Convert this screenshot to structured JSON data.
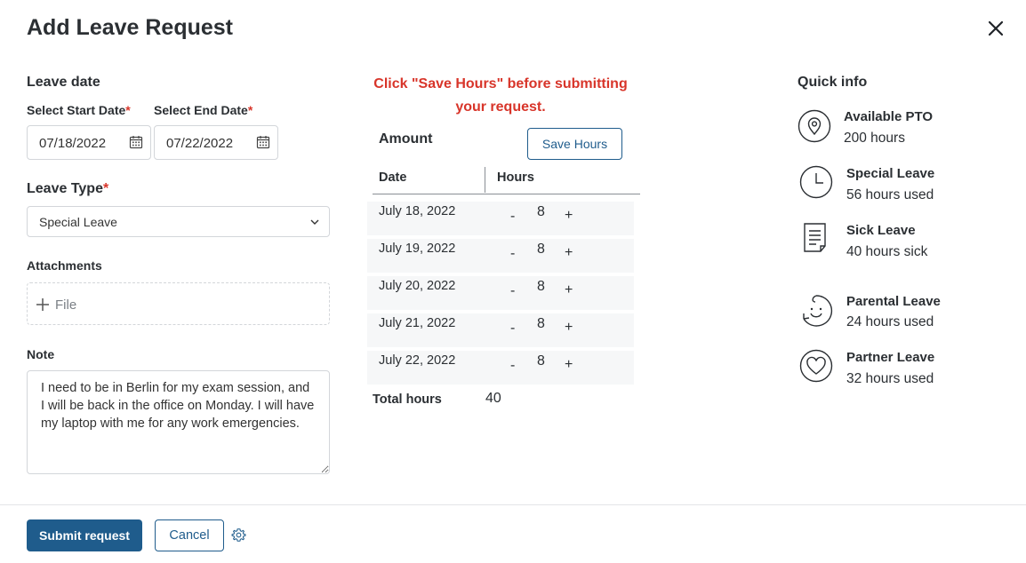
{
  "dialog": {
    "title": "Add Leave Request"
  },
  "leave_date": {
    "heading": "Leave date",
    "start_label": "Select Start Date",
    "end_label": "Select End Date",
    "required_mark": "*",
    "start_value": "07/18/2022",
    "end_value": "07/22/2022"
  },
  "leave_type": {
    "label": "Leave Type",
    "required_mark": "*",
    "value": "Special Leave"
  },
  "attachments": {
    "label": "Attachments",
    "file_label": "File"
  },
  "note": {
    "label": "Note",
    "value": "I need to be in Berlin for my exam session, and I will be back in the office on Monday. I will have my laptop with me for any work emergencies."
  },
  "amount": {
    "warning": "Click \"Save Hours\" before submitting your request.",
    "label": "Amount",
    "save_label": "Save Hours",
    "col_date": "Date",
    "col_hours": "Hours",
    "rows": [
      {
        "date": "July 18, 2022",
        "minus": "-",
        "hours": "8",
        "plus": "+"
      },
      {
        "date": "July 19, 2022",
        "minus": "-",
        "hours": "8",
        "plus": "+"
      },
      {
        "date": "July 20, 2022",
        "minus": "-",
        "hours": "8",
        "plus": "+"
      },
      {
        "date": "July 21, 2022",
        "minus": "-",
        "hours": "8",
        "plus": "+"
      },
      {
        "date": "July 22, 2022",
        "minus": "-",
        "hours": "8",
        "plus": "+"
      }
    ],
    "total_label": "Total hours",
    "total_value": "40"
  },
  "quick_info": {
    "heading": "Quick info",
    "items": [
      {
        "icon": "location-pin-icon",
        "title": "Available PTO",
        "sub": "200 hours"
      },
      {
        "icon": "clock-icon",
        "title": "Special Leave",
        "sub": "56 hours used"
      },
      {
        "icon": "document-icon",
        "title": "Sick Leave",
        "sub": "40 hours sick"
      },
      {
        "icon": "baby-face-icon",
        "title": "Parental Leave",
        "sub": "24 hours used"
      },
      {
        "icon": "heart-icon",
        "title": "Partner Leave",
        "sub": "32 hours used"
      }
    ]
  },
  "footer": {
    "submit_label": "Submit request",
    "cancel_label": "Cancel"
  },
  "colors": {
    "accent": "#1f5c8c",
    "warning": "#d8352a",
    "border": "#d3d6da"
  }
}
